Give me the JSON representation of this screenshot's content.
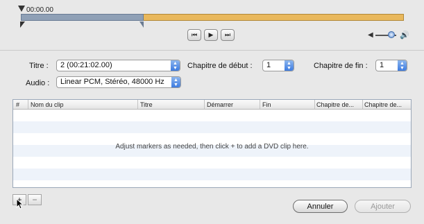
{
  "timeline": {
    "timecode": "00:00.00",
    "selection_fraction": 0.32
  },
  "transport": {
    "rewind_icon": "⏮",
    "play_icon": "▶",
    "forward_icon": "⏭"
  },
  "volume": {
    "low_icon": "◀",
    "high_icon": "🔊",
    "level": 0.75
  },
  "form": {
    "titre_label": "Titre :",
    "titre_value": "2 (00:21:02.00)",
    "chapitre_debut_label": "Chapitre de début :",
    "chapitre_debut_value": "1",
    "chapitre_fin_label": "Chapitre de fin :",
    "chapitre_fin_value": "1",
    "audio_label": "Audio :",
    "audio_value": "Linear PCM, Stéréo, 48000 Hz"
  },
  "table": {
    "columns": [
      "#",
      "Nom du clip",
      "Titre",
      "Démarrer",
      "Fin",
      "Chapitre de...",
      "Chapitre de..."
    ],
    "empty_message": "Adjust markers as needed, then click + to add a DVD clip here."
  },
  "buttons": {
    "add": "+",
    "remove": "−",
    "annuler": "Annuler",
    "ajouter": "Ajouter"
  },
  "colors": {
    "selection": "#8fa0b6",
    "track": "#e9b85c",
    "popup_accent": "#3d7be0"
  }
}
